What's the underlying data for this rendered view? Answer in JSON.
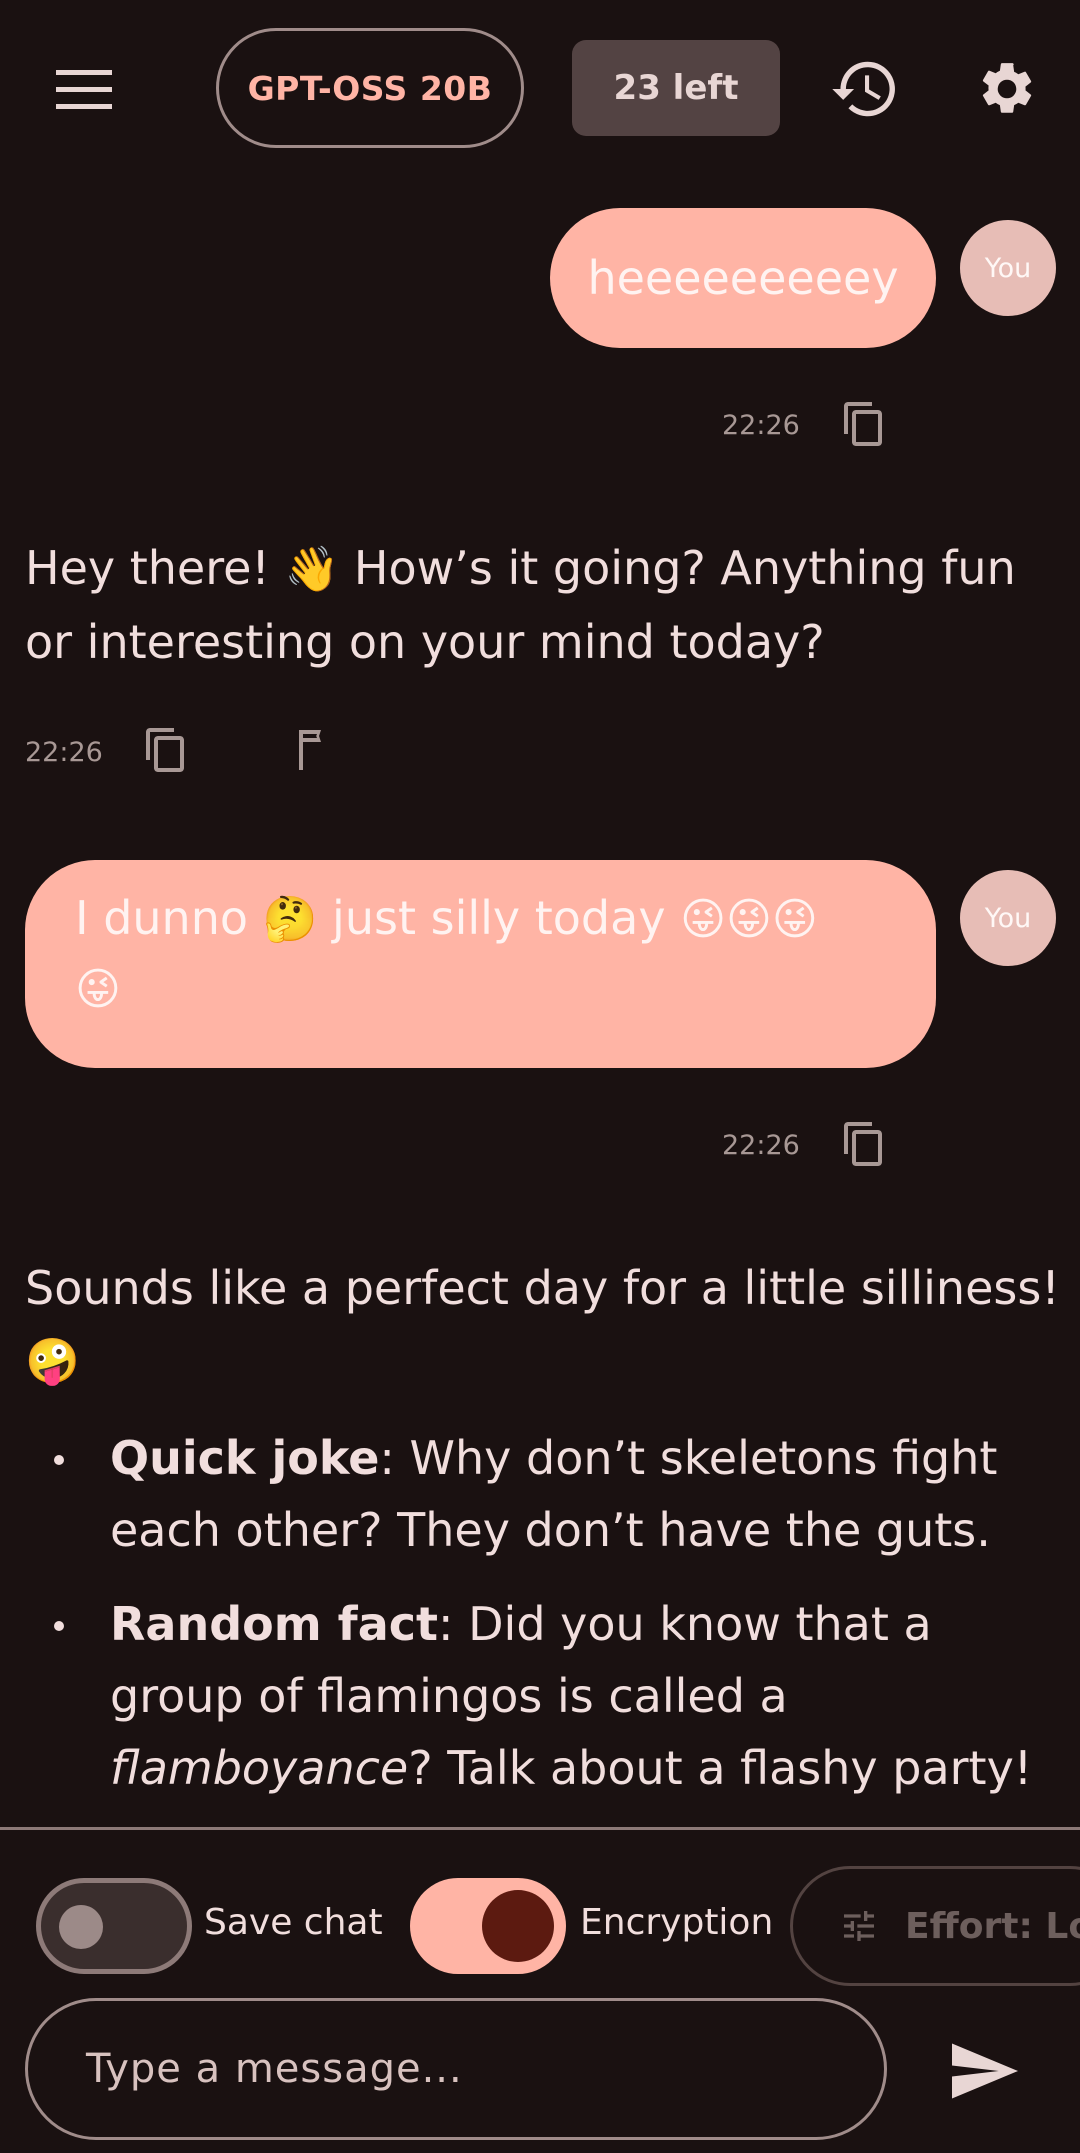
{
  "header": {
    "model_label": "GPT-OSS 20B",
    "quota_label": "23 left",
    "icons": {
      "menu": "menu-icon",
      "history": "history-icon",
      "settings": "gear-icon"
    }
  },
  "messages": [
    {
      "role": "user",
      "avatar_label": "You",
      "text": "heeeeeeeeey",
      "time": "22:26"
    },
    {
      "role": "assistant",
      "text_before": "Hey there! ",
      "emoji": "👋",
      "text_after": " How’s it going? Anything fun or interesting on your mind today?",
      "time": "22:26"
    },
    {
      "role": "user",
      "avatar_label": "You",
      "text_a": "I dunno ",
      "emoji_think": "🤔",
      "text_b": " just silly today ",
      "emoji_silly": "😜😜😜",
      "emoji_silly_2": "😜",
      "time": "22:26"
    },
    {
      "role": "assistant",
      "intro": "Sounds like a perfect day for a little silliness!",
      "intro_emoji": "🤪",
      "bullets": [
        {
          "bold": "Quick joke",
          "text": ": Why don’t skeletons fight each other? They don’t have the guts."
        },
        {
          "bold": "Random fact",
          "text_pre": ": Did you know that a group of flamingos is called a ",
          "italic": "flamboyance",
          "text_post": "? Talk about a flashy party!"
        }
      ]
    }
  ],
  "bottom_bar": {
    "save_chat_label": "Save chat",
    "save_chat_on": false,
    "encryption_label": "Encryption",
    "encryption_on": true,
    "effort_label": "Effort: Low",
    "input_placeholder": "Type a message..."
  },
  "colors": {
    "background": "#1a1111",
    "accent": "#ffb4a5",
    "text": "#f1dedd"
  }
}
